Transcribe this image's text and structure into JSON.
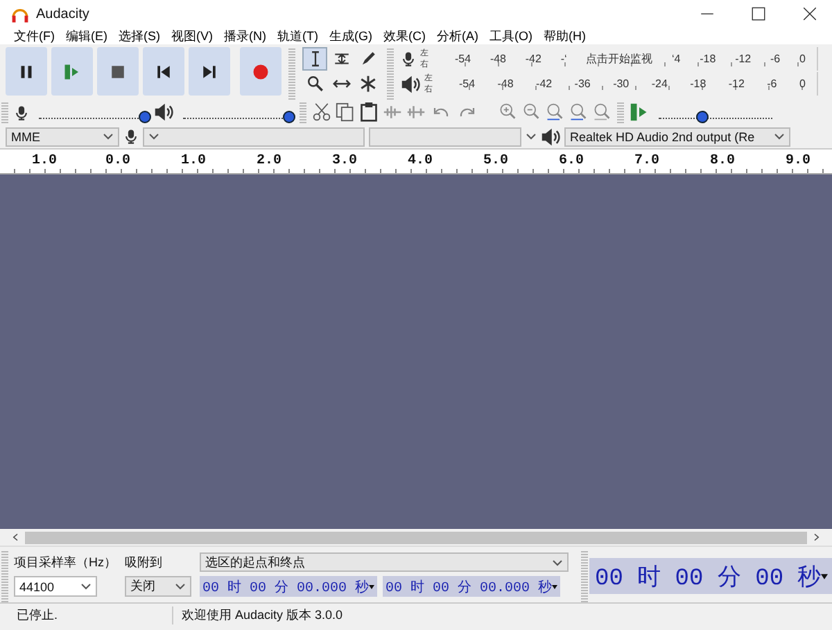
{
  "window": {
    "title": "Audacity"
  },
  "menu": [
    "文件(F)",
    "编辑(E)",
    "选择(S)",
    "视图(V)",
    "播录(N)",
    "轨道(T)",
    "生成(G)",
    "效果(C)",
    "分析(A)",
    "工具(O)",
    "帮助(H)"
  ],
  "tools": [
    {
      "selected": true
    },
    {
      "selected": false
    },
    {
      "selected": false
    },
    {
      "selected": false
    },
    {
      "selected": false
    },
    {
      "selected": false
    }
  ],
  "record_meter": {
    "left": "左",
    "right": "右",
    "ticks_before": [
      "-54",
      "-48",
      "-42",
      "-‘"
    ],
    "prompt": "点击开始监视",
    "ticks_after": [
      "‘4",
      "-18",
      "-12",
      "-6",
      "0"
    ]
  },
  "playback_meter": {
    "left": "左",
    "right": "右",
    "ticks": [
      "-54",
      "-48",
      "-42",
      "-36",
      "-30",
      "-24",
      "-18",
      "-12",
      "-6",
      "0"
    ]
  },
  "record_volume": {
    "level": 1
  },
  "playback_volume": {
    "level": 1
  },
  "play_speed": {
    "level": 0.38
  },
  "devices": {
    "host": "MME",
    "output": "Realtek HD Audio 2nd output (Re"
  },
  "ruler": [
    "1.0",
    "0.0",
    "1.0",
    "2.0",
    "3.0",
    "4.0",
    "5.0",
    "6.0",
    "7.0",
    "8.0",
    "9.0"
  ],
  "selection_toolbar": {
    "rate_label": "项目采样率（Hz）",
    "snap_label": "吸附到",
    "mode": "选区的起点和终点",
    "rate": "44100",
    "snap": "关闭",
    "start": "00 时 00 分 00.000 秒",
    "end": "00 时 00 分 00.000 秒"
  },
  "time_display": "00 时 00 分 00 秒",
  "status_bar": {
    "state": "已停止.",
    "message": "欢迎使用 Audacity 版本 3.0.0"
  }
}
